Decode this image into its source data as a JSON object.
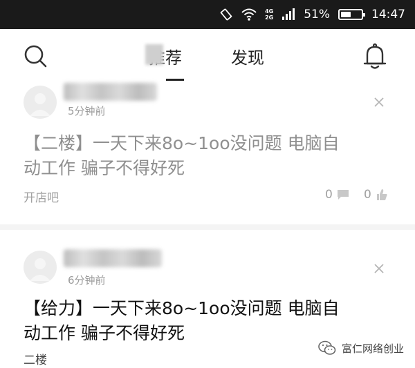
{
  "status_bar": {
    "network_top": "4G",
    "network_bottom": "2G",
    "battery_percent": "51%",
    "battery_level": 0.51,
    "time": "14:47"
  },
  "header": {
    "tabs": [
      {
        "label": "推荐",
        "active": true
      },
      {
        "label": "发现",
        "active": false
      }
    ]
  },
  "feed": [
    {
      "time": "5分钟前",
      "headline_line1": "【二楼】一天下来8o~1oo没问题 电脑自",
      "headline_line2": "动工作 骗子不得好死",
      "source": "开店吧",
      "comments": "0",
      "likes": "0",
      "read": true
    },
    {
      "time": "6分钟前",
      "headline_line1": "【给力】一天下来8o~1oo没问题 电脑自",
      "headline_line2": "动工作 骗子不得好死",
      "source": "二楼",
      "read": false
    }
  ],
  "watermark": {
    "text": "富仁网络创业"
  },
  "colors": {
    "status_bar_bg": "#1a1a1a",
    "read_text": "#8f8f8f",
    "unread_text": "#111111"
  }
}
